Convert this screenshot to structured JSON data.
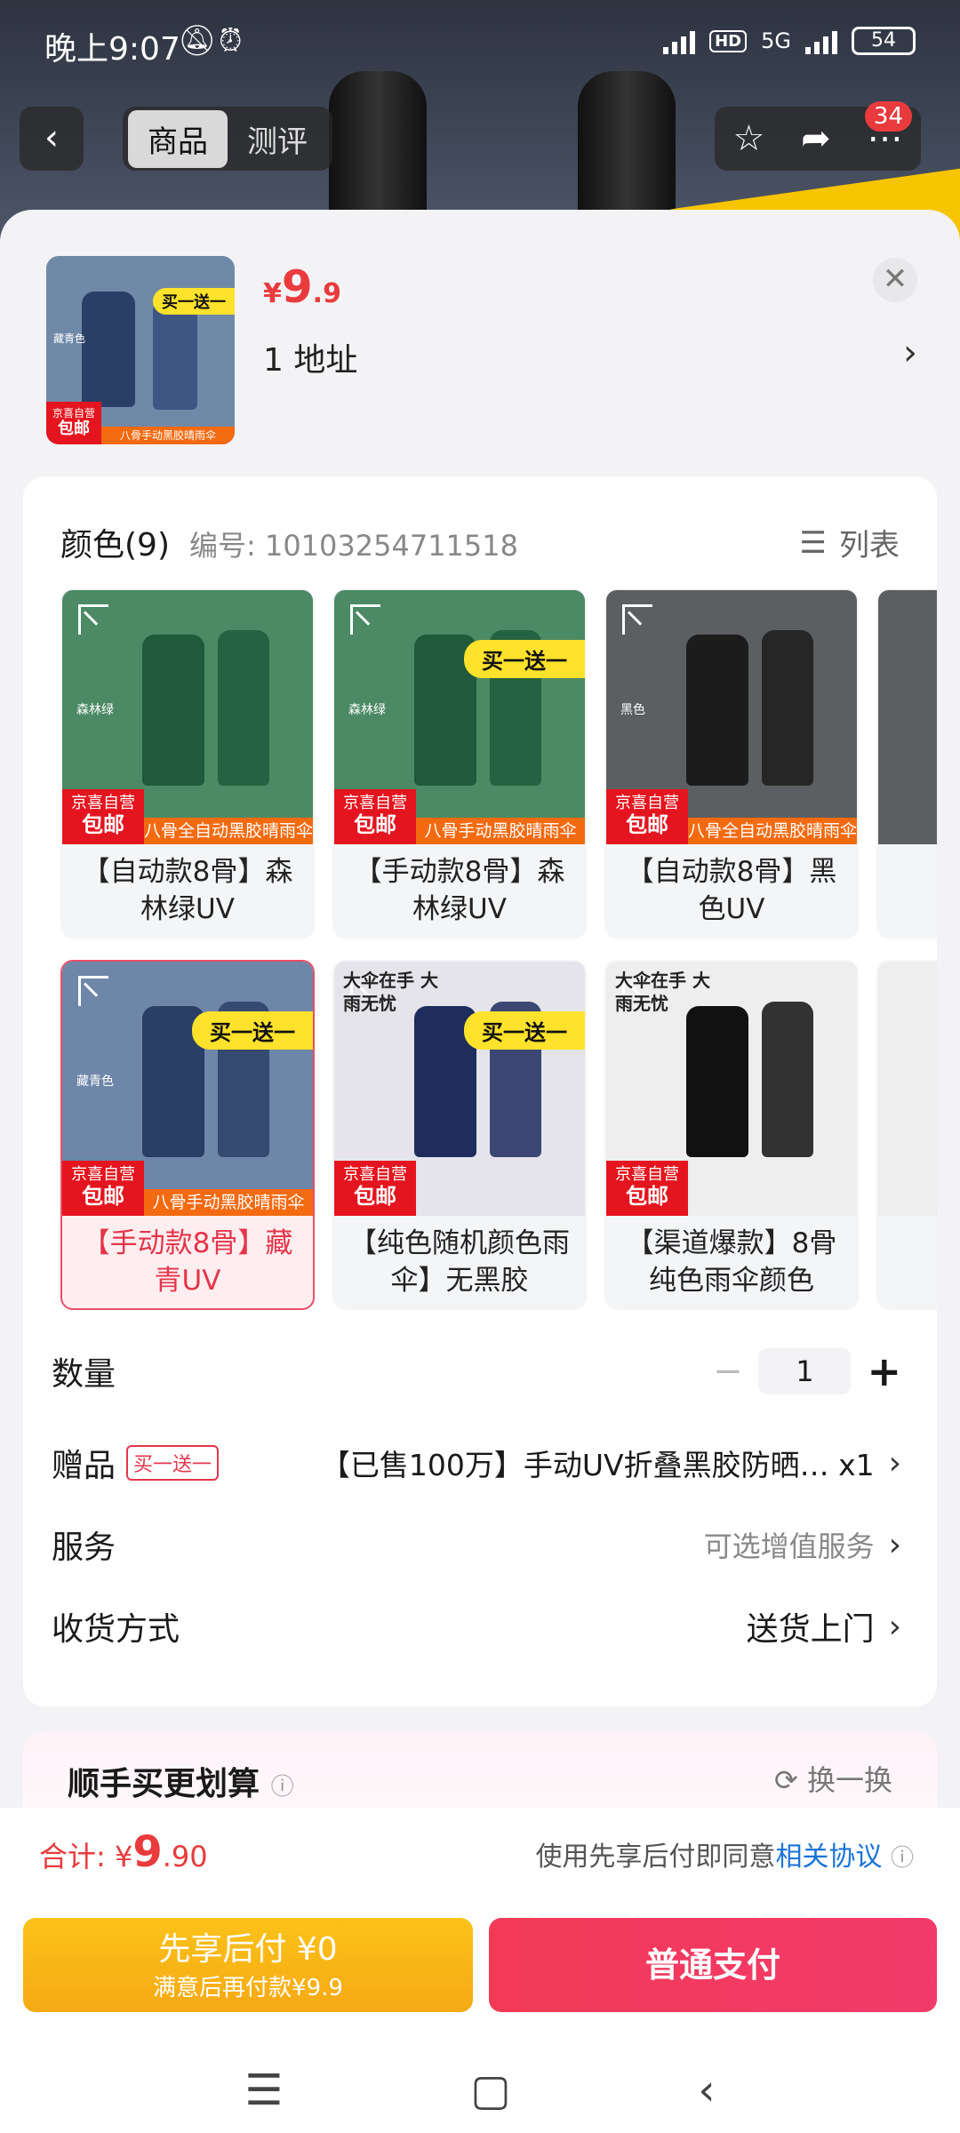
{
  "status": {
    "time": "晚上9:07",
    "network": "5G",
    "hd": "HD",
    "battery": "54"
  },
  "nav": {
    "tabs": [
      "商品",
      "测评"
    ],
    "notification_count": "34"
  },
  "product": {
    "price_currency": "¥",
    "price_int": "9",
    "price_dec": ".9",
    "address": "1  地址",
    "thumb_tag": "买一送一",
    "thumb_strip": "八骨手动黑胶晴雨伞",
    "thumb_side": "藏青色"
  },
  "color_section": {
    "title": "颜色(9)",
    "code": "编号: 10103254711518",
    "list_label": "列表"
  },
  "common_tags": {
    "jd_top": "京喜自营",
    "jd_bottom": "包邮"
  },
  "options": [
    {
      "label": "【自动款8骨】森林绿UV",
      "strip": "八骨全自动黑胶晴雨伞",
      "side": "森林绿",
      "promo": "",
      "bg": "#4b8a64",
      "umb": "#1f5a3b"
    },
    {
      "label": "【手动款8骨】森林绿UV",
      "strip": "八骨手动黑胶晴雨伞",
      "side": "森林绿",
      "promo": "买一送一",
      "bg": "#4b8a64",
      "umb": "#1f5a3b"
    },
    {
      "label": "【自动款8骨】黑色UV",
      "strip": "八骨全自动黑胶晴雨伞",
      "side": "黑色",
      "promo": "",
      "bg": "#5c5f62",
      "umb": "#1c1c1c"
    },
    {
      "label": "【手动款8骨】藏青UV",
      "strip": "八骨手动黑胶晴雨伞",
      "side": "藏青色",
      "promo": "买一送一",
      "bg": "#6e86a8",
      "umb": "#2a3f66"
    },
    {
      "label": "【纯色随机颜色雨伞】无黑胶",
      "strip": "",
      "side": "大伞在手 大雨无忧",
      "promo": "买一送一",
      "bg": "#e4e4ea",
      "umb": "#1e2c5e"
    },
    {
      "label": "【渠道爆款】8骨纯色雨伞颜色",
      "strip": "",
      "side": "大伞在手 大雨无忧",
      "promo": "",
      "bg": "#eeeeee",
      "umb": "#111111"
    }
  ],
  "rows": {
    "quantity_label": "数量",
    "quantity_value": "1",
    "gift_label": "赠品",
    "gift_tag": "买一送一",
    "gift_value": "【已售100万】手动UV折叠黑胶防晒… x1",
    "service_label": "服务",
    "service_value": "可选增值服务",
    "delivery_label": "收货方式",
    "delivery_value": "送货上门"
  },
  "recommend": {
    "title": "顺手买更划算",
    "refresh": "换一换"
  },
  "footer": {
    "total_label": "合计: ",
    "total_currency": "¥",
    "total_int": "9",
    "total_dec": ".90",
    "agree_prefix": "使用先享后付即同意",
    "agree_link": "相关协议",
    "later_line1": "先享后付 ¥0",
    "later_line2": "满意后再付款¥9.9",
    "pay_label": "普通支付"
  },
  "colors": {
    "accent": "#e93b3d",
    "pay_button": "#f23a57",
    "later_button": "#f6b216",
    "link": "#1a73d8"
  }
}
